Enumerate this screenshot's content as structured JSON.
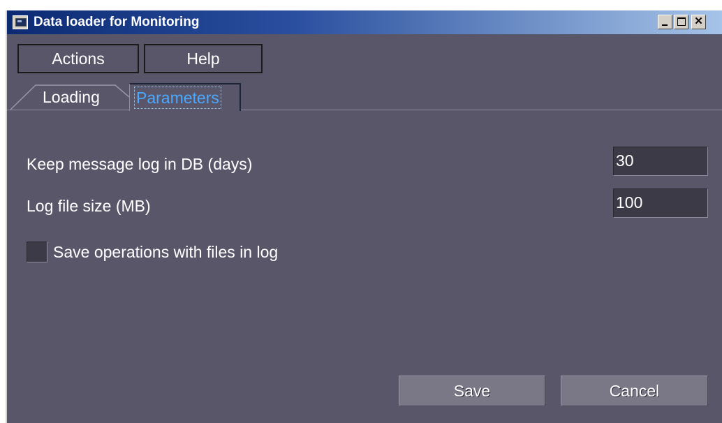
{
  "window": {
    "title": "Data loader for Monitoring"
  },
  "menu": {
    "actions_label": "Actions",
    "help_label": "Help"
  },
  "tabs": [
    {
      "label": "Loading",
      "active": false
    },
    {
      "label": "Parameters",
      "active": true
    }
  ],
  "params": {
    "keep_log_label": "Keep message log in DB (days)",
    "keep_log_value": "30",
    "log_size_label": "Log file size (MB)",
    "log_size_value": "100",
    "save_ops_label": "Save operations with files in log",
    "save_ops_checked": false
  },
  "buttons": {
    "save_label": "Save",
    "cancel_label": "Cancel"
  },
  "colors": {
    "background": "#5a5669",
    "active_tab_text": "#4aa8ff",
    "title_bar_start": "#0c2a73",
    "title_bar_end": "#a6c4e8"
  }
}
